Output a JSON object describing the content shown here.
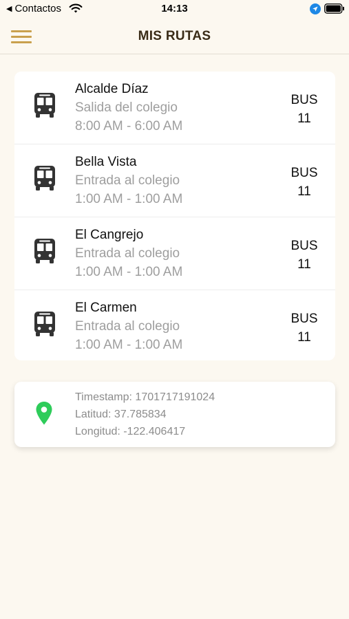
{
  "status_bar": {
    "back_label": "Contactos",
    "time": "14:13"
  },
  "header": {
    "title": "MIS RUTAS"
  },
  "routes": [
    {
      "name": "Alcalde Díaz",
      "type": "Salida del colegio",
      "time": "8:00 AM - 6:00 AM",
      "bus_label": "BUS",
      "bus_number": "11"
    },
    {
      "name": "Bella Vista",
      "type": "Entrada al colegio",
      "time": "1:00 AM - 1:00 AM",
      "bus_label": "BUS",
      "bus_number": "11"
    },
    {
      "name": "El Cangrejo",
      "type": "Entrada al colegio",
      "time": "1:00 AM - 1:00 AM",
      "bus_label": "BUS",
      "bus_number": "11"
    },
    {
      "name": "El Carmen",
      "type": "Entrada al colegio",
      "time": "1:00 AM - 1:00 AM",
      "bus_label": "BUS",
      "bus_number": "11"
    }
  ],
  "location": {
    "timestamp": "Timestamp: 1701717191024",
    "latitude": "Latitud: 37.785834",
    "longitude": "Longitud: -122.406417"
  },
  "icons": {
    "menu": "hamburger-menu-icon",
    "bus": "bus-icon",
    "pin": "location-pin-icon",
    "wifi": "wifi-icon",
    "location_arrow": "location-arrow-icon",
    "battery": "battery-icon"
  },
  "colors": {
    "background": "#fcf8f0",
    "accent": "#c9a04d",
    "title": "#3a2c17",
    "pin": "#2ecc5a",
    "secondary_text": "#9e9e9e",
    "location_arrow": "#1e88e5"
  }
}
